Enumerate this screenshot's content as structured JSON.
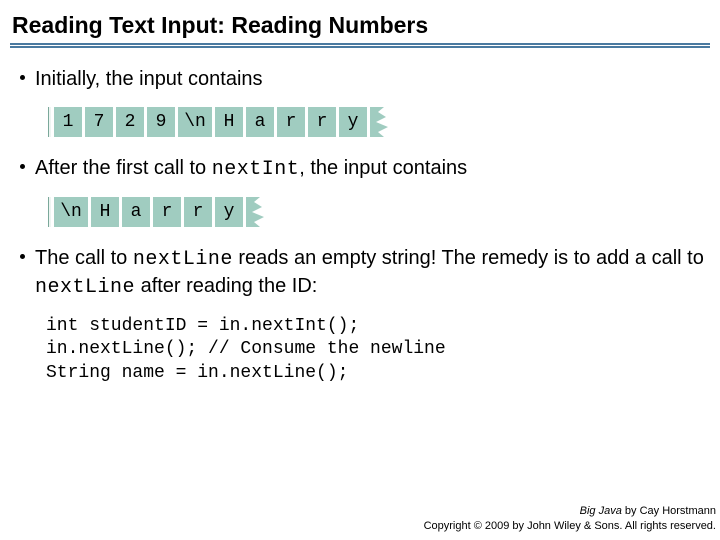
{
  "title": "Reading Text Input: Reading Numbers",
  "b1": "Initially, the input contains",
  "b2_pre": "After the first call to ",
  "b2_code": "nextInt",
  "b2_post": ", the input contains",
  "b3_pre": "The call to ",
  "b3_code1": "nextLine",
  "b3_mid": " reads an empty string! The remedy is to add a call to ",
  "b3_code2": "nextLine",
  "b3_post": " after reading the ID:",
  "tiles1": [
    "1",
    "7",
    "2",
    "9",
    "\\n",
    "H",
    "a",
    "r",
    "r",
    "y"
  ],
  "tiles2": [
    "\\n",
    "H",
    "a",
    "r",
    "r",
    "y"
  ],
  "codeblock": "int studentID = in.nextInt();\nin.nextLine(); // Consume the newline\nString name = in.nextLine();",
  "footer_book": "Big Java",
  "footer_by": " by Cay Horstmann",
  "footer_cr": "Copyright © 2009 by John Wiley & Sons.  All rights reserved."
}
